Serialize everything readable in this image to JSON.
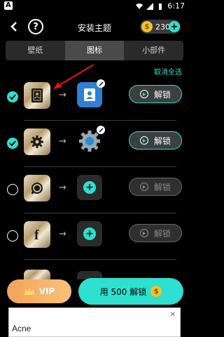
{
  "status_bar": {
    "left_badge": "A",
    "time": "6:17"
  },
  "header": {
    "title": "安装主题",
    "coins": "230",
    "coin_symbol": "$"
  },
  "tabs": [
    {
      "label": "壁纸",
      "active": false
    },
    {
      "label": "图标",
      "active": true
    },
    {
      "label": "小部件",
      "active": false
    }
  ],
  "deselect_all": "取消全选",
  "rows": [
    {
      "checked": true,
      "original_icon": "contacts-icon",
      "new_icon": "contacts-blue-icon",
      "unlock_label": "解锁",
      "unlock_active": true
    },
    {
      "checked": true,
      "original_icon": "gear-icon",
      "new_icon": "settings-gear-icon",
      "unlock_label": "解锁",
      "unlock_active": true
    },
    {
      "checked": false,
      "original_icon": "whatsapp-icon",
      "new_icon": "add-icon",
      "unlock_label": "解锁",
      "unlock_active": false
    },
    {
      "checked": false,
      "original_icon": "facebook-icon",
      "new_icon": "add-icon",
      "unlock_label": "解锁",
      "unlock_active": false
    }
  ],
  "vip_button": "VIP",
  "buy_button": "用 500 解锁",
  "ad": {
    "text": "Acne",
    "close": "✕"
  },
  "colors": {
    "accent": "#2de0cf",
    "coin": "#f3c230",
    "vip": "#f4a35a"
  }
}
